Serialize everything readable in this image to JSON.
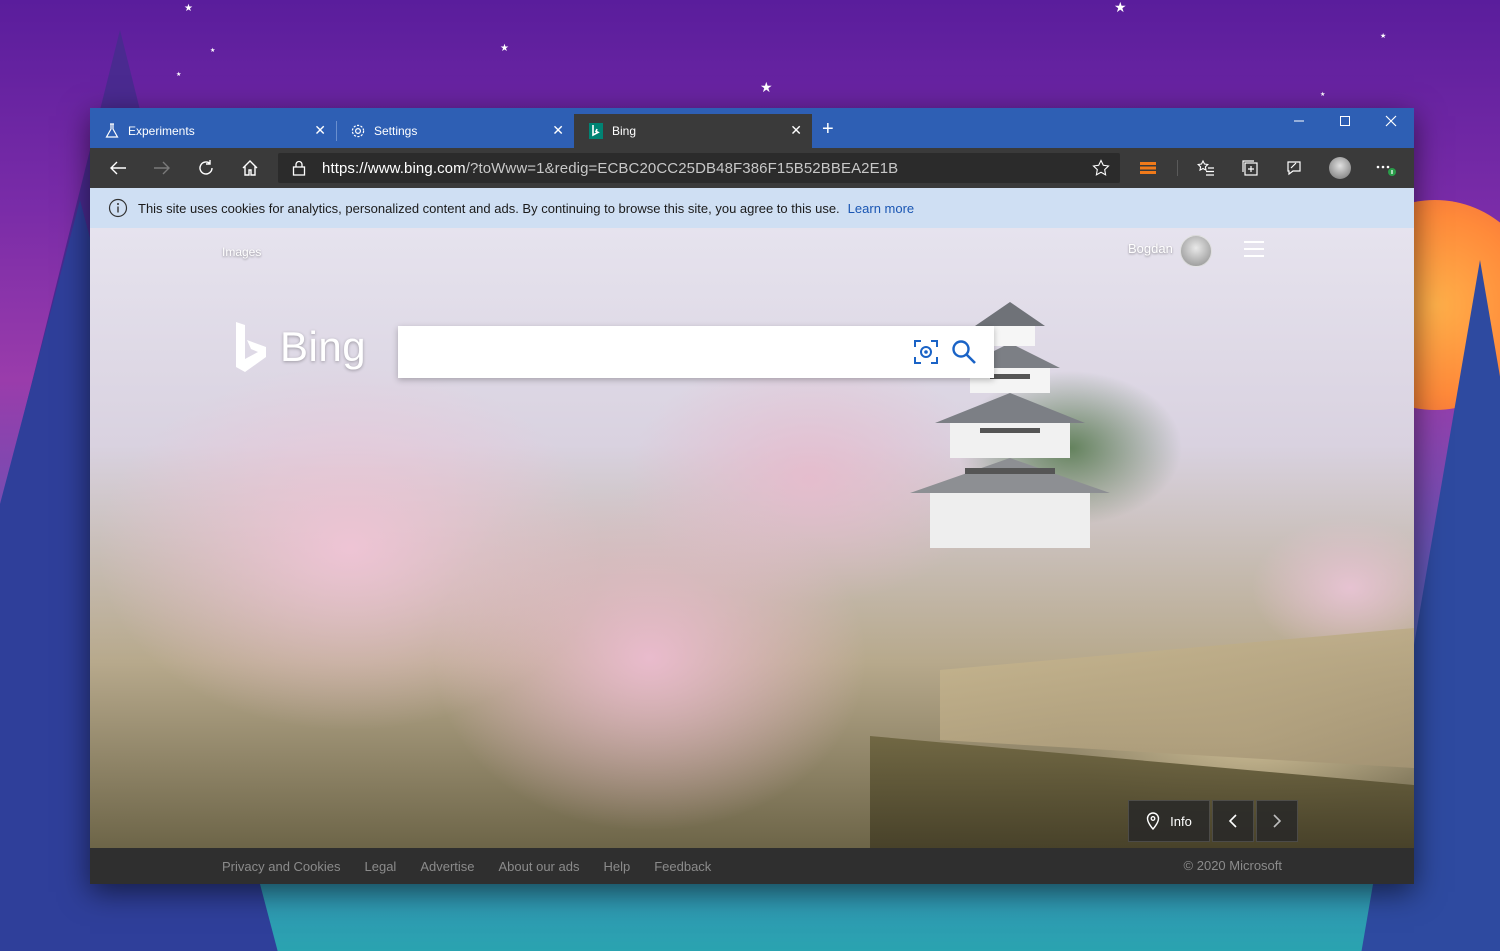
{
  "browser": {
    "tabs": [
      {
        "label": "Experiments",
        "icon": "flask-icon"
      },
      {
        "label": "Settings",
        "icon": "gear-icon"
      },
      {
        "label": "Bing",
        "icon": "bing-logo-icon"
      }
    ],
    "new_tab_label": "+",
    "address": {
      "host": "https://www.bing.com",
      "path": "/?toWww=1&redig=ECBC20CC25DB48F386F15B52BBEA2E1B"
    },
    "toolbar_icons": [
      "back-icon",
      "forward-icon",
      "refresh-icon",
      "home-icon",
      "lock-icon",
      "star-icon",
      "extension-icon",
      "favorites-icon",
      "collections-icon",
      "feedback-icon",
      "profile-icon",
      "more-icon"
    ]
  },
  "infobar": {
    "message": "This site uses cookies for analytics, personalized content and ads. By continuing to browse this site, you agree to this use.",
    "link": "Learn more"
  },
  "page": {
    "nav_images": "Images",
    "user_name": "Bogdan",
    "logo_text": "Bing",
    "search_placeholder": "",
    "info_label": "Info"
  },
  "footer": {
    "links": [
      "Privacy and Cookies",
      "Legal",
      "Advertise",
      "About our ads",
      "Help",
      "Feedback"
    ],
    "copyright": "© 2020 Microsoft"
  },
  "colors": {
    "titlebar": "#2e5fb4",
    "toolbar": "#3a3a3a",
    "infobar": "#cfdff3",
    "link": "#1a56b3"
  }
}
